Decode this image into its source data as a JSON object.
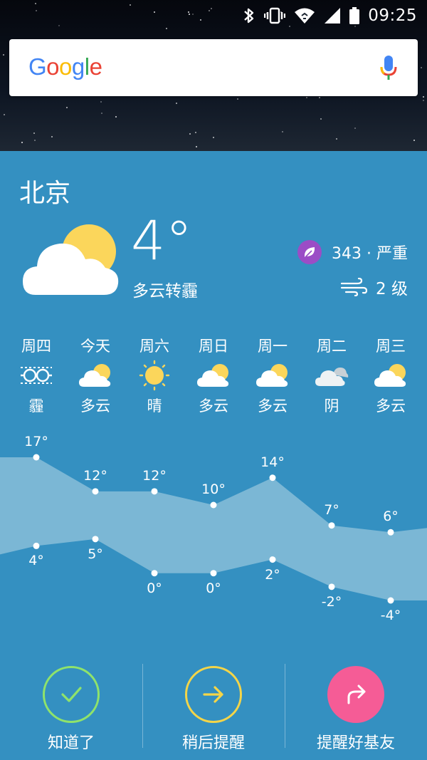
{
  "status_bar": {
    "time": "09:25"
  },
  "search": {
    "logo_letters": [
      "G",
      "o",
      "o",
      "g",
      "l",
      "e"
    ],
    "logo_colors": [
      "#4285F4",
      "#EA4335",
      "#FBBC05",
      "#4285F4",
      "#34A853",
      "#EA4335"
    ]
  },
  "weather": {
    "city": "北京",
    "temperature": "4°",
    "condition": "多云转霾",
    "aqi": "343 · 严重",
    "wind": "2 级",
    "forecast": [
      {
        "day": "周四",
        "condition": "霾",
        "icon": "haze-icon",
        "high": "17°",
        "low": "4°",
        "high_value": 17,
        "low_value": 4
      },
      {
        "day": "今天",
        "condition": "多云",
        "icon": "partly-cloudy-icon",
        "high": "12°",
        "low": "5°",
        "high_value": 12,
        "low_value": 5
      },
      {
        "day": "周六",
        "condition": "晴",
        "icon": "sun-icon",
        "high": "12°",
        "low": "0°",
        "high_value": 12,
        "low_value": 0
      },
      {
        "day": "周日",
        "condition": "多云",
        "icon": "partly-cloudy-icon",
        "high": "10°",
        "low": "0°",
        "high_value": 10,
        "low_value": 0
      },
      {
        "day": "周一",
        "condition": "多云",
        "icon": "partly-cloudy-icon",
        "high": "14°",
        "low": "2°",
        "high_value": 14,
        "low_value": 2
      },
      {
        "day": "周二",
        "condition": "阴",
        "icon": "overcast-icon",
        "high": "7°",
        "low": "-2°",
        "high_value": 7,
        "low_value": -2
      },
      {
        "day": "周三",
        "condition": "多云",
        "icon": "partly-cloudy-icon",
        "high": "6°",
        "low": "-4°",
        "high_value": 6,
        "low_value": -4
      }
    ]
  },
  "actions": [
    {
      "label": "知道了",
      "icon": "check-icon",
      "color": "#8fe36b"
    },
    {
      "label": "稍后提醒",
      "icon": "arrow-right-icon",
      "color": "#f4d548"
    },
    {
      "label": "提醒好基友",
      "icon": "share-icon",
      "color": "#f55c96"
    }
  ],
  "colors": {
    "panel": "#3490c1",
    "band": "#7fb9d6",
    "aqi_badge": "#9b4dc6"
  }
}
